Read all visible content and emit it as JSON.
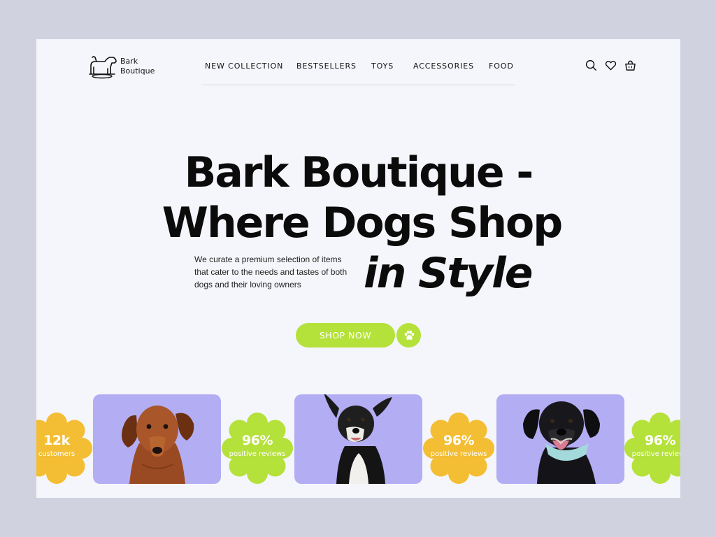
{
  "brand": {
    "line1": "Bark",
    "line2": "Boutique"
  },
  "nav": {
    "items": [
      {
        "label": "NEW COLLECTION"
      },
      {
        "label": "BESTSELLERS"
      },
      {
        "label": "TOYS"
      },
      {
        "label": "ACCESSORIES"
      },
      {
        "label": "FOOD"
      }
    ]
  },
  "header_icons": [
    "search-icon",
    "heart-icon",
    "shopping-bag-icon"
  ],
  "hero": {
    "title_line1": "Bark Boutique -",
    "title_line2": "Where Dogs Shop",
    "title_line3": "in Style",
    "description": "We curate a premium selection of items that cater to the needs and tastes of both dogs and their loving owners",
    "cta_label": "SHOP NOW",
    "cta_icon": "paw-icon"
  },
  "stats": [
    {
      "value": "12k",
      "label": "customers",
      "color": "#f3be33"
    },
    {
      "value": "96%",
      "label": "positive reviews",
      "color": "#b5e13b"
    },
    {
      "value": "96%",
      "label": "positive reviews",
      "color": "#f3be33"
    },
    {
      "value": "96%",
      "label": "positive reviews",
      "color": "#b5e13b"
    }
  ],
  "cards": [
    {
      "subject": "dachshund-photo"
    },
    {
      "subject": "terrier-mix-photo"
    },
    {
      "subject": "black-labrador-photo"
    }
  ],
  "colors": {
    "accent_green": "#b5e13b",
    "accent_yellow": "#f3be33",
    "card_purple": "#b3adf4",
    "page_bg": "#f5f6fb",
    "outer_bg": "#d0d2e0"
  }
}
